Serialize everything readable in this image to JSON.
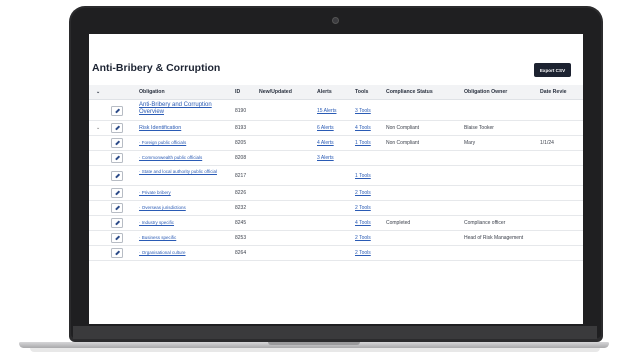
{
  "page": {
    "title": "Anti-Bribery & Corruption",
    "export_label": "Export CSV"
  },
  "table": {
    "headers": {
      "obligation": "Obligation",
      "id": "ID",
      "new_updated": "New/Updated",
      "alerts": "Alerts",
      "tools": "Tools",
      "compliance": "Compliance Status",
      "owner": "Obligation Owner",
      "review": "Date Revie"
    },
    "rows": [
      {
        "obligation": "Anti-Bribery and Corruption Overview",
        "id": "8190",
        "alerts": "15 Alerts",
        "tools": "3 Tools",
        "compliance": "",
        "owner": "",
        "review": ""
      },
      {
        "obligation": "Risk Identification",
        "id": "8193",
        "alerts": "6 Alerts",
        "tools": "4 Tools",
        "compliance": "Non Compliant",
        "owner": "Blaise Tooker",
        "review": ""
      },
      {
        "obligation": "·  Foreign public officials",
        "id": "8205",
        "alerts": "4 Alerts",
        "tools": "1 Tools",
        "compliance": "Non Compliant",
        "owner": "Mary",
        "review": "1/1/24"
      },
      {
        "obligation": "·  Commonwealth public officials",
        "id": "8208",
        "alerts": "3 Alerts",
        "tools": "",
        "compliance": "",
        "owner": "",
        "review": ""
      },
      {
        "obligation": "·  State and local authority public official",
        "id": "8217",
        "alerts": "",
        "tools": "1 Tools",
        "compliance": "",
        "owner": "",
        "review": ""
      },
      {
        "obligation": "·  Private bribery",
        "id": "8226",
        "alerts": "",
        "tools": "2 Tools",
        "compliance": "",
        "owner": "",
        "review": ""
      },
      {
        "obligation": "·  Overseas jurisdictions",
        "id": "8232",
        "alerts": "",
        "tools": "2 Tools",
        "compliance": "",
        "owner": "",
        "review": ""
      },
      {
        "obligation": "·  Industry specific",
        "id": "8245",
        "alerts": "",
        "tools": "4 Tools",
        "compliance": "Completed",
        "owner": "Compliance officer",
        "review": ""
      },
      {
        "obligation": "·  Business specific",
        "id": "8253",
        "alerts": "",
        "tools": "2 Tools",
        "compliance": "",
        "owner": "Head of Risk Management",
        "review": ""
      },
      {
        "obligation": "·  Organisational culture",
        "id": "8264",
        "alerts": "",
        "tools": "2 Tools",
        "compliance": "",
        "owner": "",
        "review": ""
      }
    ]
  },
  "colors": {
    "accent_link": "#2a5bb5",
    "button_dark": "#1c2230",
    "laptop_frame": "#2b2b2d"
  }
}
